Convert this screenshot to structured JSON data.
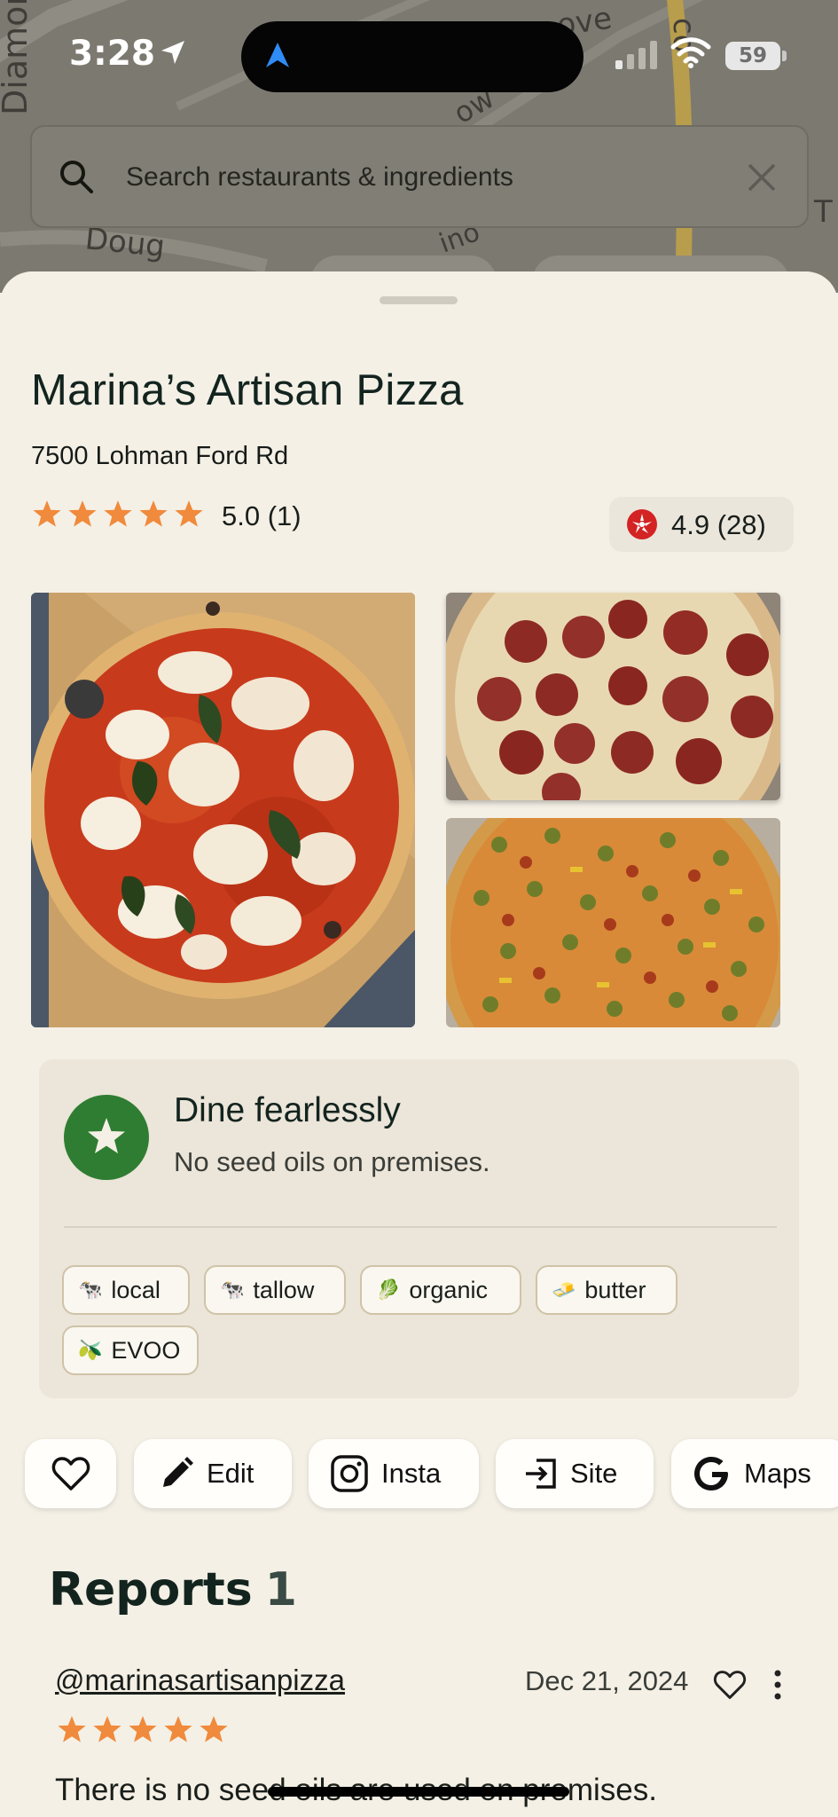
{
  "status_bar": {
    "time": "3:28",
    "battery": "59"
  },
  "search": {
    "placeholder": "Search restaurants & ingredients"
  },
  "restaurant": {
    "name": "Marina’s Artisan Pizza",
    "address": "7500 Lohman Ford Rd",
    "rating_text": "5.0 (1)",
    "rating_value": 5,
    "yelp_text": "4.9 (28)"
  },
  "photos": [
    {
      "name": "margherita-pizza"
    },
    {
      "name": "pepperoni-pizza"
    },
    {
      "name": "supreme-pizza"
    }
  ],
  "dine_card": {
    "title": "Dine fearlessly",
    "subtitle": "No seed oils on premises.",
    "tags": [
      {
        "label": "local",
        "icon": "cow-icon"
      },
      {
        "label": "tallow",
        "icon": "cow-icon"
      },
      {
        "label": "organic",
        "icon": "leaf-icon"
      },
      {
        "label": "butter",
        "icon": "butter-icon"
      },
      {
        "label": "EVOO",
        "icon": "olive-icon"
      }
    ]
  },
  "actions": {
    "favorite": "",
    "edit": "Edit",
    "insta": "Insta",
    "site": "Site",
    "maps": "Maps"
  },
  "reports": {
    "title": "Reports",
    "count": "1",
    "items": [
      {
        "user": "@marinasartisanpizza",
        "date": "Dec 21, 2024",
        "stars": 5,
        "text": "There is no seed oils are used on premises."
      }
    ]
  },
  "colors": {
    "accent_star": "#f08a3c",
    "badge_green": "#2f7d32",
    "yelp_red": "#d32323",
    "sheet_bg": "#f4f0e6"
  }
}
